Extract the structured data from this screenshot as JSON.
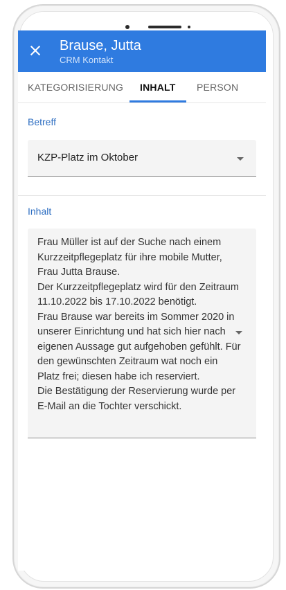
{
  "header": {
    "title": "Brause, Jutta",
    "subtitle": "CRM Kontakt"
  },
  "tabs": [
    {
      "label": "KATEGORISIERUNG"
    },
    {
      "label": "INHALT"
    },
    {
      "label": "PERSON"
    }
  ],
  "active_tab": "INHALT",
  "betreff": {
    "label": "Betreff",
    "value": "KZP-Platz im Oktober"
  },
  "inhalt": {
    "label": "Inhalt",
    "lines": [
      "Frau Müller ist auf der Suche nach einem",
      "Kurzzeitpflegeplatz für ihre mobile Mutter,",
      "Frau Jutta Brause.",
      "Der Kurzzeitpflegeplatz wird für den Zeitraum",
      "11.10.2022 bis 17.10.2022 benötigt.",
      "Frau Brause war bereits im Sommer 2020 in",
      "unserer Einrichtung und hat sich hier nach",
      "eigenen Aussage gut aufgehoben gefühlt. Für",
      "den gewünschten Zeitraum wat noch ein",
      "Platz frei; diesen habe ich reserviert.",
      "Die Bestätigung der Reservierung wurde per",
      "E-Mail an die Tochter verschickt."
    ]
  },
  "colors": {
    "accent": "#2f7be0",
    "label": "#2f6fc2"
  }
}
